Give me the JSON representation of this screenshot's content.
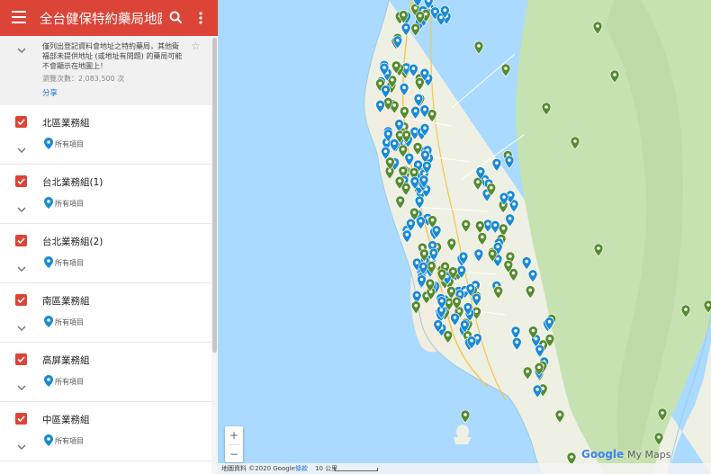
{
  "header": {
    "title": "全台健保特約藥局地圖 ...",
    "menu_icon": "menu-icon",
    "search_icon": "search-icon",
    "more_icon": "more-vert-icon",
    "color": "#db4437"
  },
  "description": {
    "text": "僅列出登記資料會地址之特約藥局，其他衛福部未提供地址 (或地址有問題) 的藥局可能不會顯示在地圖上！",
    "views": "瀏覽次數：2,083,500 次",
    "share_label": "分享"
  },
  "layers": [
    {
      "name": "北區業務組",
      "items_label": "所有項目",
      "checked": true
    },
    {
      "name": "台北業務組(1)",
      "items_label": "所有項目",
      "checked": true
    },
    {
      "name": "台北業務組(2)",
      "items_label": "所有項目",
      "checked": true
    },
    {
      "name": "南區業務組",
      "items_label": "所有項目",
      "checked": true
    },
    {
      "name": "高屏業務組",
      "items_label": "所有項目",
      "checked": true
    },
    {
      "name": "中區業務組",
      "items_label": "所有項目",
      "checked": true
    }
  ],
  "map": {
    "zoom_in": "+",
    "zoom_out": "−",
    "footer_data": "地圖資料 ©2020 Google",
    "footer_terms": "條款",
    "footer_scale": "10 公里",
    "logo_google": "Google",
    "logo_suffix": "My Maps",
    "colors": {
      "sea": "#aadaff",
      "land": "#eef0e4",
      "forest": "#c6e2b1",
      "urban": "#f2eddf",
      "pin_blue": "#1a8ad4",
      "pin_green": "#558b2f"
    }
  }
}
